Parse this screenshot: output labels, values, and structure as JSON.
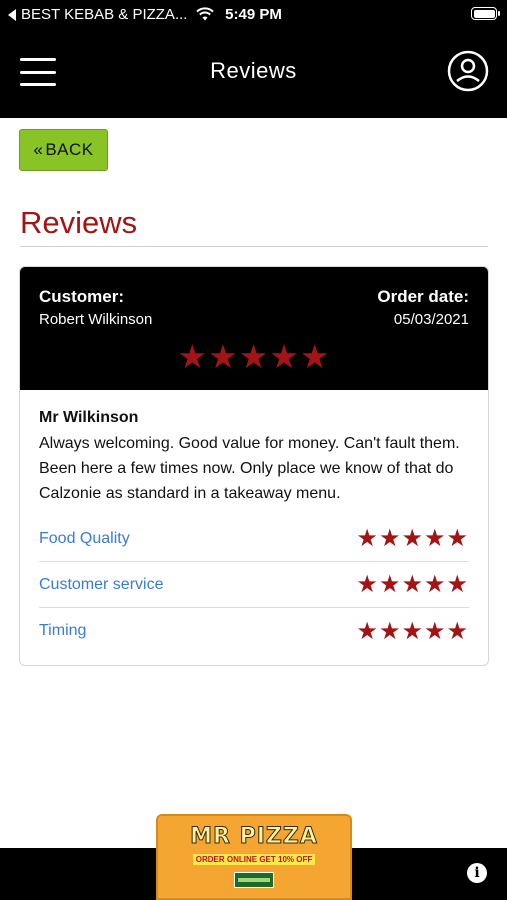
{
  "status_bar": {
    "back_app": "BEST KEBAB & PIZZA...",
    "time": "5:49 PM"
  },
  "header": {
    "title": "Reviews"
  },
  "back_button": {
    "label": "BACK"
  },
  "page_title": "Reviews",
  "review": {
    "customer_label": "Customer:",
    "customer_name": "Robert Wilkinson",
    "order_date_label": "Order date:",
    "order_date": "05/03/2021",
    "overall_rating": 5,
    "overall_stars": "★★★★★",
    "title": "Mr Wilkinson",
    "body": "Always welcoming. Good value for money. Can't fault them. Been here a few times now. Only place we know of that do Calzonie as standard in a takeaway menu.",
    "ratings": [
      {
        "label": "Food Quality",
        "rating": 5,
        "stars": "★★★★★"
      },
      {
        "label": "Customer service",
        "rating": 5,
        "stars": "★★★★★"
      },
      {
        "label": "Timing",
        "rating": 5,
        "stars": "★★★★★"
      }
    ]
  },
  "promo": {
    "logo": "MR PIZZA",
    "text": "ORDER ONLINE GET 10% OFF"
  },
  "colors": {
    "accent_red": "#a31515",
    "back_green": "#88c425",
    "link_blue": "#3a7bd5"
  }
}
